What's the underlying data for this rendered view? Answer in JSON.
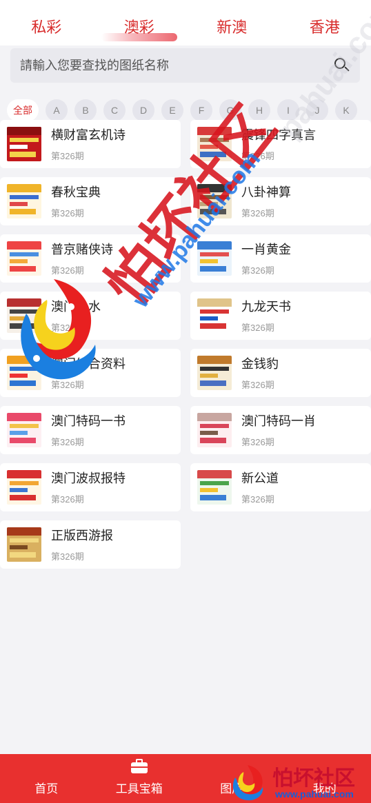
{
  "top_tabs": [
    {
      "label": "私彩",
      "active": false
    },
    {
      "label": "澳彩",
      "active": true
    },
    {
      "label": "新澳",
      "active": false
    },
    {
      "label": "香港",
      "active": false
    }
  ],
  "search": {
    "placeholder": "請輸入您要查找的图纸名称",
    "icon": "search-icon"
  },
  "letters": [
    "全部",
    "A",
    "B",
    "C",
    "D",
    "E",
    "F",
    "G",
    "H",
    "I",
    "J",
    "K"
  ],
  "items": [
    {
      "title": "横财富玄机诗",
      "issue": "第326期"
    },
    {
      "title": "震锋四字真言",
      "issue": "第326期"
    },
    {
      "title": "春秋宝典",
      "issue": "第326期"
    },
    {
      "title": "八卦神算",
      "issue": "第326期"
    },
    {
      "title": "普京赌侠诗",
      "issue": "第326期"
    },
    {
      "title": "一肖黄金",
      "issue": "第326期"
    },
    {
      "title": "澳门心水",
      "issue": "第326期"
    },
    {
      "title": "九龙天书",
      "issue": "第326期"
    },
    {
      "title": "澳门综合资料",
      "issue": "第326期"
    },
    {
      "title": "金钱豹",
      "issue": "第326期"
    },
    {
      "title": "澳门特码一书",
      "issue": "第326期"
    },
    {
      "title": "澳门特码一肖",
      "issue": "第326期"
    },
    {
      "title": "澳门波叔报特",
      "issue": "第326期"
    },
    {
      "title": "新公道",
      "issue": "第326期"
    },
    {
      "title": "正版西游报",
      "issue": "第326期"
    }
  ],
  "watermark": {
    "text": "怕坏社区",
    "url": "www.pahuai.com",
    "url_right": "pahuai.com"
  },
  "bottom_nav": [
    {
      "label": "首页",
      "icon": "home-icon"
    },
    {
      "label": "工具宝箱",
      "icon": "toolbox-icon"
    },
    {
      "label": "图库",
      "icon": "gallery-icon"
    },
    {
      "label": "我的",
      "icon": "user-icon"
    }
  ],
  "bottom_logo": {
    "text": "怕坏社区",
    "url": "www.pahuai.com"
  },
  "colors": {
    "accent": "#d82c2c",
    "nav_bg": "#e8302f",
    "page_bg": "#f3f3f6",
    "url_blue": "#1e78e6"
  }
}
